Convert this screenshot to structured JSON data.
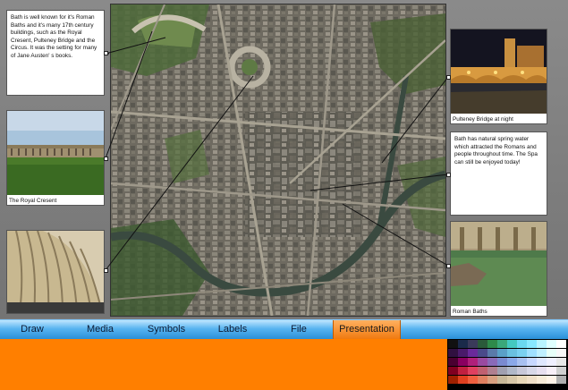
{
  "callouts": {
    "top_left": "Bath is well known for it's Roman Baths and it's many 17th century buildings, such as the Royal Cresent, Pulteney Bridge and the Circus. It was the setting for many of Jane Austen' s books.",
    "right_middle": "Bath has natural spring water which attracted the Romans and people throughout time. The Spa can still be enjoyed today!"
  },
  "photos": {
    "royal_crescent": "The Royal Cresent",
    "pulteney_bridge": "Pulteney Bridge at night",
    "roman_baths": "Roman Baths"
  },
  "menu": {
    "tabs": [
      "Draw",
      "Media",
      "Symbols",
      "Labels",
      "File",
      "Presentation"
    ],
    "active": "Presentation"
  },
  "colors": {
    "menu_bar": "#2a8fd8",
    "active_tab": "#f07a10",
    "bottom_panel": "#ff7f00"
  },
  "palette": [
    [
      "#111111",
      "#1a2a4a",
      "#3a3a5a",
      "#2a5a3a",
      "#2e8a4a",
      "#3aa87a",
      "#44c8c0",
      "#6ad8f0",
      "#88e8ff",
      "#b8f4ff",
      "#e0ffff",
      "#ffffff"
    ],
    [
      "#301040",
      "#4a1a6a",
      "#6a2a9a",
      "#4a4a8a",
      "#5a7aaa",
      "#5aa0c8",
      "#6ac0e0",
      "#7ad0f0",
      "#a0e0ff",
      "#c0f0ff",
      "#e8fff8",
      "#f8f8f8"
    ],
    [
      "#4a0030",
      "#8a0060",
      "#b0207a",
      "#9a4aa0",
      "#8a6ab8",
      "#7a8ad0",
      "#8aa8e8",
      "#a8c0f0",
      "#c8d8ff",
      "#e0e8ff",
      "#f0f0ff",
      "#e8e8e8"
    ],
    [
      "#800020",
      "#c02040",
      "#e04060",
      "#c06070",
      "#b08090",
      "#a0a0b0",
      "#b0b8c8",
      "#c8c8d8",
      "#d8d8e8",
      "#e8e0f0",
      "#f8f0f8",
      "#d0d0d0"
    ],
    [
      "#a02000",
      "#e04020",
      "#f06040",
      "#e08060",
      "#d8a080",
      "#c8b898",
      "#d8c8a8",
      "#e8d8b8",
      "#f0e0c8",
      "#f8ecd8",
      "#fff4e8",
      "#b0b0b0"
    ]
  ]
}
